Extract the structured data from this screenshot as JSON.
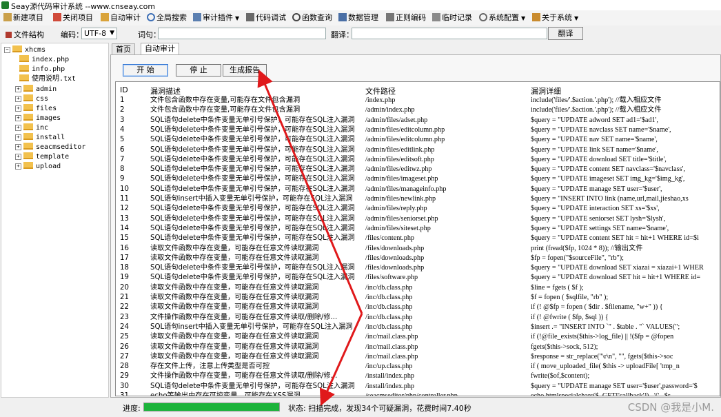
{
  "window": {
    "title": "Seay源代码审计系统  --www.cnseay.com"
  },
  "menu": [
    {
      "label": "新建项目",
      "icon": "new-project-icon",
      "dropdown": false
    },
    {
      "label": "关闭项目",
      "icon": "close-project-icon",
      "dropdown": false
    },
    {
      "label": "自动审计",
      "icon": "auto-audit-icon",
      "dropdown": false
    },
    {
      "label": "全局搜索",
      "icon": "global-search-icon",
      "dropdown": false
    },
    {
      "label": "审计插件",
      "icon": "plugin-icon",
      "dropdown": true
    },
    {
      "label": "代码调试",
      "icon": "debug-icon",
      "dropdown": false
    },
    {
      "label": "函数查询",
      "icon": "function-search-icon",
      "dropdown": false
    },
    {
      "label": "数据管理",
      "icon": "data-manage-icon",
      "dropdown": false
    },
    {
      "label": "正则编码",
      "icon": "regex-encode-icon",
      "dropdown": false
    },
    {
      "label": "临时记录",
      "icon": "temp-record-icon",
      "dropdown": false
    },
    {
      "label": "系统配置",
      "icon": "settings-icon",
      "dropdown": true
    },
    {
      "label": "关于系统",
      "icon": "about-icon",
      "dropdown": true
    }
  ],
  "toolbar2": {
    "structure_label": "文件结构",
    "encoding_label": "编码：",
    "encoding_value": "UTF-8",
    "word_label": "词句：",
    "word_value": "",
    "translate_label": "翻译：",
    "translate_value": "",
    "translate_button": "翻译"
  },
  "tree": {
    "root": "xhcms",
    "files": [
      "index.php",
      "info.php",
      "使用说明.txt"
    ],
    "folders": [
      "admin",
      "css",
      "files",
      "images",
      "inc",
      "install",
      "seacmseditor",
      "template",
      "upload"
    ]
  },
  "tabs": [
    "首页",
    "自动审计"
  ],
  "buttons": {
    "start": "开 始",
    "stop": "停 止",
    "report": "生成报告"
  },
  "table": {
    "headers": [
      "ID",
      "漏洞描述",
      "文件路径",
      "漏洞详细"
    ],
    "rows": [
      [
        "1",
        "文件包含函数中存在变量,可能存在文件包含漏洞",
        "/index.php",
        "include('files/'.$action.'.php'); //载入相应文件"
      ],
      [
        "2",
        "文件包含函数中存在变量,可能存在文件包含漏洞",
        "/admin/index.php",
        "include('files/'.$action.'.php'); //载入相应文件"
      ],
      [
        "3",
        "SQL语句delete中条件变量无单引号保护，可能存在SQL注入漏洞",
        "/admin/files/adset.php",
        "$query = \"UPDATE adword SET ad1='$ad1',"
      ],
      [
        "4",
        "SQL语句delete中条件变量无单引号保护，可能存在SQL注入漏洞",
        "/admin/files/editcolumn.php",
        "$query = \"UPDATE navclass SET name='$name',"
      ],
      [
        "5",
        "SQL语句delete中条件变量无单引号保护，可能存在SQL注入漏洞",
        "/admin/files/editcolumn.php",
        "$query = \"UPDATE nav SET name='$name',"
      ],
      [
        "6",
        "SQL语句delete中条件变量无单引号保护，可能存在SQL注入漏洞",
        "/admin/files/editlink.php",
        "$query = \"UPDATE link SET name='$name',"
      ],
      [
        "7",
        "SQL语句delete中条件变量无单引号保护，可能存在SQL注入漏洞",
        "/admin/files/editsoft.php",
        "$query = \"UPDATE download SET title='$title',"
      ],
      [
        "8",
        "SQL语句delete中条件变量无单引号保护，可能存在SQL注入漏洞",
        "/admin/files/editwz.php",
        "$query = \"UPDATE content SET navclass='$navclass',"
      ],
      [
        "9",
        "SQL语句delete中条件变量无单引号保护，可能存在SQL注入漏洞",
        "/admin/files/imageset.php",
        "$query = \"UPDATE imageset SET img_kg='$img_kg',"
      ],
      [
        "10",
        "SQL语句delete中条件变量无单引号保护，可能存在SQL注入漏洞",
        "/admin/files/manageinfo.php",
        "$query = \"UPDATE manage SET user='$user',"
      ],
      [
        "11",
        "SQL语句insert中插入变量无单引号保护，可能存在SQL注入漏洞",
        "/admin/files/newlink.php",
        "$query = \"INSERT INTO link (name,url,mail,jieshao,xs"
      ],
      [
        "12",
        "SQL语句delete中条件变量无单引号保护，可能存在SQL注入漏洞",
        "/admin/files/reply.php",
        "$query = \"UPDATE interaction SET xs='$xs',"
      ],
      [
        "13",
        "SQL语句delete中条件变量无单引号保护，可能存在SQL注入漏洞",
        "/admin/files/seniorset.php",
        "$query = \"UPDATE seniorset SET lysh='$lysh',"
      ],
      [
        "14",
        "SQL语句delete中条件变量无单引号保护，可能存在SQL注入漏洞",
        "/admin/files/siteset.php",
        "$query = \"UPDATE settings SET name='$name',"
      ],
      [
        "15",
        "SQL语句delete中条件变量无单引号保护，可能存在SQL注入漏洞",
        "/files/content.php",
        "$query = \"UPDATE content SET hit = hit+1 WHERE id=$i"
      ],
      [
        "16",
        "读取文件函数中存在变量，可能存在任意文件读取漏洞",
        "/files/downloads.php",
        "print (fread($fp, 1024 * 8)); //输出文件"
      ],
      [
        "17",
        "读取文件函数中存在变量，可能存在任意文件读取漏洞",
        "/files/downloads.php",
        "$fp = fopen(\"$sourceFile\", \"rb\");"
      ],
      [
        "18",
        "SQL语句delete中条件变量无单引号保护，可能存在SQL注入漏洞",
        "/files/downloads.php",
        "$query = \"UPDATE download SET xiazai = xiazai+1 WHER"
      ],
      [
        "19",
        "SQL语句delete中条件变量无单引号保护，可能存在SQL注入漏洞",
        "/files/software.php",
        "$query = \"UPDATE download SET hit = hit+1 WHERE id="
      ],
      [
        "20",
        "读取文件函数中存在变量，可能存在任意文件读取漏洞",
        "/inc/db.class.php",
        "$line = fgets ( $f );"
      ],
      [
        "21",
        "读取文件函数中存在变量，可能存在任意文件读取漏洞",
        "/inc/db.class.php",
        "$f = fopen ( $sqlfile, \"rb\" );"
      ],
      [
        "22",
        "读取文件函数中存在变量，可能存在任意文件读取漏洞",
        "/inc/db.class.php",
        "if (! @$fp = fopen ( $dir . $filename, \"w+\" )) {"
      ],
      [
        "23",
        "文件操作函数中存在变量，可能存在任意文件读取/删除/修...",
        "/inc/db.class.php",
        "if (! @fwrite ( $fp, $sql )) {"
      ],
      [
        "24",
        "SQL语句insert中插入变量无单引号保护，可能存在SQL注入漏洞",
        "/inc/db.class.php",
        "$insert .= \"INSERT INTO `\" . $table . \"` VALUES(\";"
      ],
      [
        "25",
        "读取文件函数中存在变量，可能存在任意文件读取漏洞",
        "/inc/mail.class.php",
        "if (!@file_exists($this->log_file) || !($fp = @fopen"
      ],
      [
        "26",
        "读取文件函数中存在变量，可能存在任意文件读取漏洞",
        "/inc/mail.class.php",
        "fgets($this->sock, 512);"
      ],
      [
        "27",
        "读取文件函数中存在变量，可能存在任意文件读取漏洞",
        "/inc/mail.class.php",
        "$response = str_replace(\"\\r\\n\", \"\", fgets($this->soc"
      ],
      [
        "28",
        "存在文件上传，注意上传类型是否可控",
        "/inc/up.class.php",
        "if ( move_uploaded_file( $this -> uploadFile[ 'tmp_n"
      ],
      [
        "29",
        "文件操作函数中存在变量，可能存在任意文件读取/删除/修...",
        "/install/index.php",
        "fwrite($of,$content);"
      ],
      [
        "30",
        "SQL语句delete中条件变量无单引号保护，可能存在SQL注入漏洞",
        "/install/index.php",
        "$query = \"UPDATE manage SET user='$user',password='$"
      ],
      [
        "31",
        "echo等输出中存在可控变量，可能存在XSS漏洞",
        "/seacmseditor/php/controller.php",
        "echo htmlspecialchars($_GET['callback']) . '(' . $r"
      ]
    ]
  },
  "status": {
    "progress_label": "进度:",
    "progress_percent": 100,
    "status_text": "状态: 扫描完成，发现34个可疑漏洞，花费时间7.40秒"
  },
  "watermark": "CSDN @我是小M.",
  "colors": {
    "progress": "#1bb33a",
    "arrow": "#e0191b",
    "folder": "#f2c14e",
    "app_icon": "#1e7d2c"
  }
}
